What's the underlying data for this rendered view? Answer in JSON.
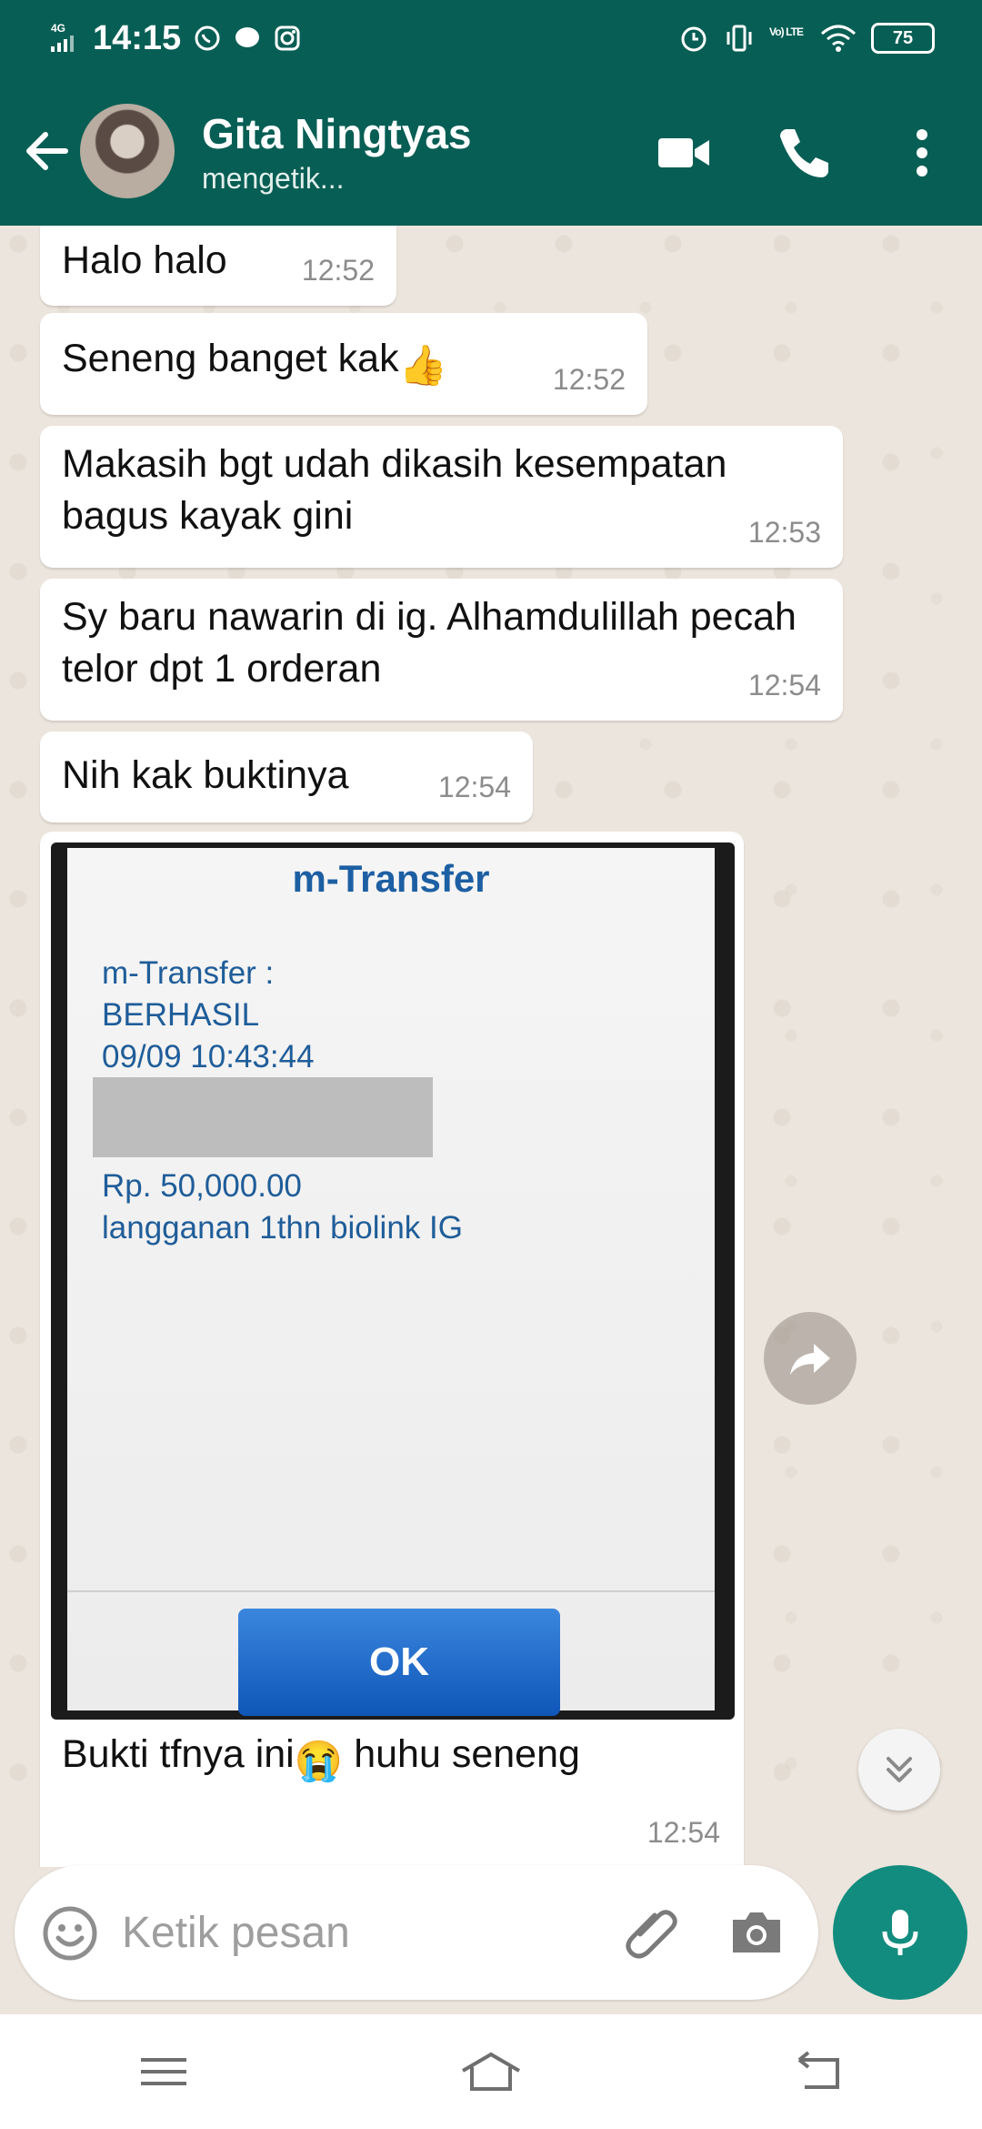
{
  "status_bar": {
    "network": "4G",
    "time": "14:15",
    "volte": "Vo) LTE",
    "battery": "75"
  },
  "header": {
    "contact_name": "Gita Ningtyas",
    "contact_status": "mengetik..."
  },
  "messages": [
    {
      "text": "Halo halo",
      "time": "12:52"
    },
    {
      "text": "Seneng banget kak",
      "emoji": "👍",
      "time": "12:52"
    },
    {
      "text": "Makasih bgt udah dikasih kesempatan bagus kayak gini",
      "time": "12:53"
    },
    {
      "text": "Sy baru nawarin di ig. Alhamdulillah pecah telor dpt 1 orderan",
      "time": "12:54"
    },
    {
      "text": "Nih kak buktinya",
      "time": "12:54"
    }
  ],
  "image_message": {
    "title": "m-Transfer",
    "lines": [
      "m-Transfer :",
      "BERHASIL",
      "09/09 10:43:44",
      "Rp. 50,000.00",
      "langganan 1thn biolink IG"
    ],
    "ok_label": "OK",
    "caption_before": "Bukti tfnya ini",
    "caption_emoji": "😭",
    "caption_after": " huhu seneng",
    "time": "12:54"
  },
  "composer": {
    "placeholder": "Ketik pesan"
  },
  "icons": {
    "back": "arrow-left-icon",
    "video": "video-call-icon",
    "call": "phone-icon",
    "menu": "more-vert-icon",
    "forward": "share-forward-icon",
    "scroll": "chevron-double-down-icon",
    "emoji": "emoji-icon",
    "attach": "paperclip-icon",
    "camera": "camera-icon",
    "mic": "microphone-icon"
  },
  "colors": {
    "header": "#075e54",
    "mic": "#128c7e",
    "chat_bg": "#ece5dd",
    "bubble": "#ffffff"
  }
}
